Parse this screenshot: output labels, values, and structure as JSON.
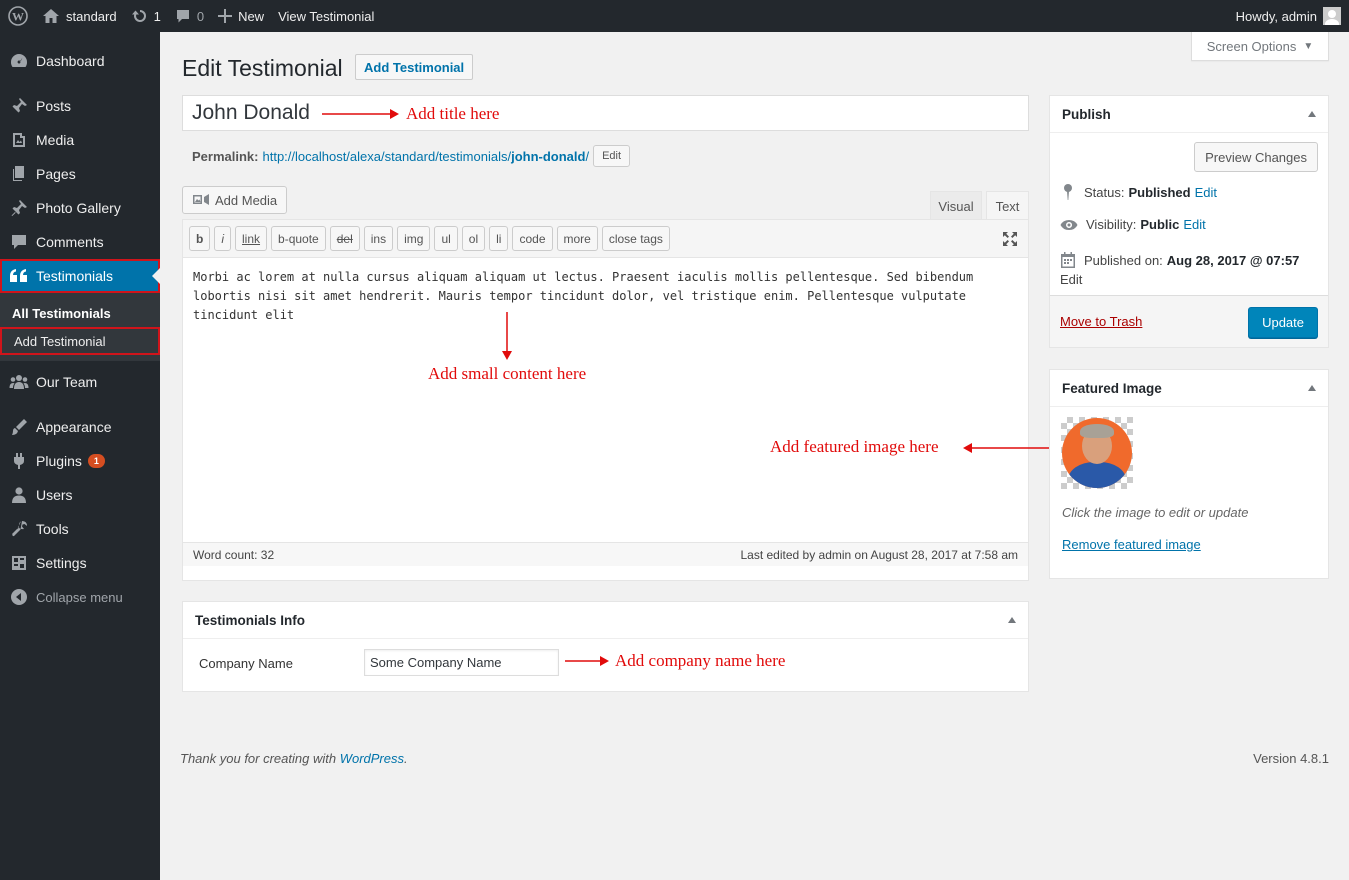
{
  "adminbar": {
    "site_name": "standard",
    "updates_count": "1",
    "comments_count": "0",
    "new_label": "New",
    "view_label": "View Testimonial",
    "howdy": "Howdy, admin"
  },
  "sidebar": {
    "items": [
      {
        "label": "Dashboard",
        "icon": "dashboard-icon"
      },
      {
        "label": "Posts",
        "icon": "pin-icon"
      },
      {
        "label": "Media",
        "icon": "media-icon"
      },
      {
        "label": "Pages",
        "icon": "pages-icon"
      },
      {
        "label": "Photo Gallery",
        "icon": "pin-icon"
      },
      {
        "label": "Comments",
        "icon": "comment-icon"
      },
      {
        "label": "Testimonials",
        "icon": "quote-icon"
      },
      {
        "label": "Our Team",
        "icon": "team-icon"
      },
      {
        "label": "Appearance",
        "icon": "brush-icon"
      },
      {
        "label": "Plugins",
        "icon": "plug-icon",
        "badge": "1"
      },
      {
        "label": "Users",
        "icon": "user-icon"
      },
      {
        "label": "Tools",
        "icon": "wrench-icon"
      },
      {
        "label": "Settings",
        "icon": "settings-icon"
      }
    ],
    "submenu": [
      "All Testimonials",
      "Add Testimonial"
    ],
    "collapse_label": "Collapse menu"
  },
  "header": {
    "title": "Edit Testimonial",
    "add_new": "Add Testimonial",
    "screen_options": "Screen Options"
  },
  "post": {
    "title": "John Donald",
    "permalink_label": "Permalink:",
    "permalink_base": "http://localhost/alexa/standard/testimonials/",
    "permalink_slug": "john-donald",
    "permalink_tail": "/",
    "edit_label": "Edit"
  },
  "editor": {
    "add_media": "Add Media",
    "tab_visual": "Visual",
    "tab_text": "Text",
    "quicktags": [
      "b",
      "i",
      "link",
      "b-quote",
      "del",
      "ins",
      "img",
      "ul",
      "ol",
      "li",
      "code",
      "more",
      "close tags"
    ],
    "content": "Morbi ac lorem at nulla cursus aliquam aliquam ut lectus. Praesent iaculis mollis pellentesque. Sed bibendum lobortis nisi sit amet hendrerit. Mauris tempor tincidunt dolor, vel tristique enim. Pellentesque vulputate tincidunt elit",
    "word_count": "Word count: 32",
    "last_edited": "Last edited by admin on August 28, 2017 at 7:58 am"
  },
  "testimonials_info": {
    "heading": "Testimonials Info",
    "company_label": "Company Name",
    "company_value": "Some Company Name"
  },
  "publish": {
    "heading": "Publish",
    "preview": "Preview Changes",
    "status_label": "Status:",
    "status_value": "Published",
    "visibility_label": "Visibility:",
    "visibility_value": "Public",
    "published_label": "Published on:",
    "published_value": "Aug 28, 2017 @ 07:57",
    "edit": "Edit",
    "trash": "Move to Trash",
    "update": "Update"
  },
  "featured": {
    "heading": "Featured Image",
    "caption": "Click the image to edit or update",
    "remove": "Remove featured image"
  },
  "footer": {
    "thanks_prefix": "Thank you for creating with ",
    "wp_link": "WordPress",
    "thanks_suffix": ".",
    "version": "Version 4.8.1"
  },
  "annotations": {
    "title": "Add title here",
    "content": "Add small content here",
    "image": "Add featured image here",
    "company": "Add company name here"
  },
  "colors": {
    "admin_dark": "#23282d",
    "primary": "#0073aa",
    "annotation_red": "#e10b0b"
  }
}
